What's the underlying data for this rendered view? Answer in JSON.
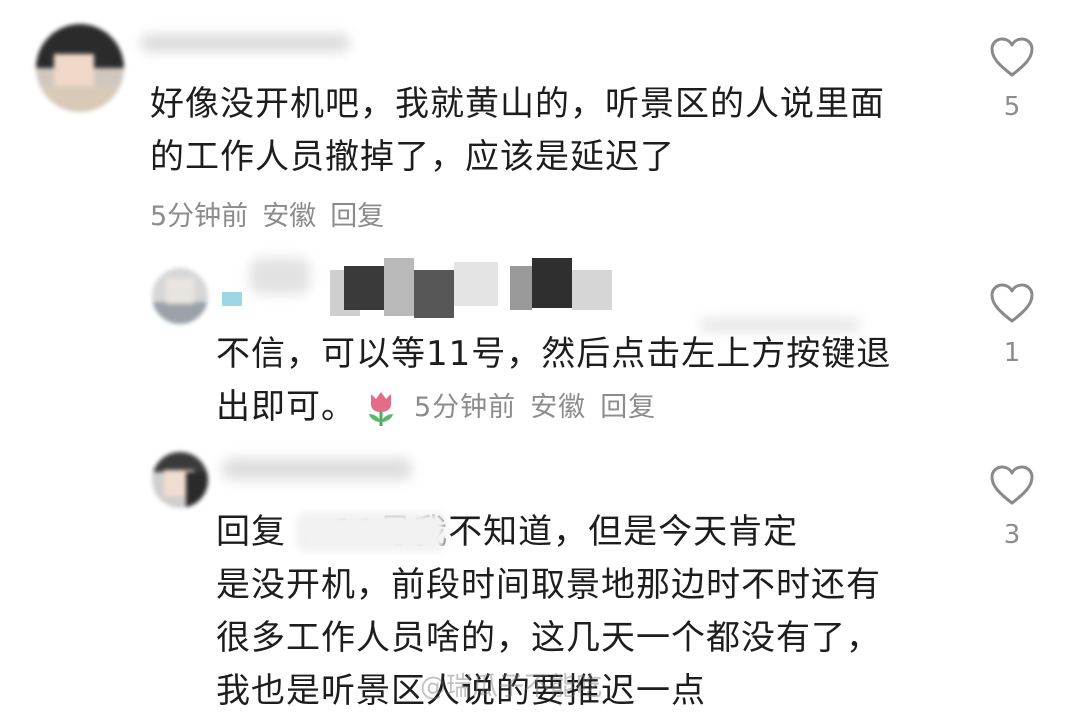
{
  "comments": [
    {
      "text_lines": [
        "好像没开机吧，我就黄山的，听景区的人说里面",
        "的工作人员撤掉了，应该是延迟了"
      ],
      "time": "5分钟前",
      "location": "安徽",
      "reply_label": "回复",
      "likes": "5"
    },
    {
      "text_lines": [
        "不信，可以等11号，然后点击左上方按键退",
        "出即可。"
      ],
      "emoji": "tulip",
      "time": "5分钟前",
      "location": "安徽",
      "reply_label": "回复",
      "likes": "1"
    },
    {
      "text_lines": [
        "回复       ：11号我不知道，但是今天肯定",
        "是没开机，前段时间取景地那边时不时还有",
        "很多工作人员啥的，这几天一个都没有了，",
        "我也是听景区人说的要推迟一点"
      ],
      "likes": "3"
    }
  ],
  "watermark": "@瑞瓜子不能吃",
  "colors": {
    "text": "#1d1d1d",
    "meta": "#8c8c8c",
    "heart_stroke": "#8a8a8a",
    "tulip": "#e56c87"
  }
}
